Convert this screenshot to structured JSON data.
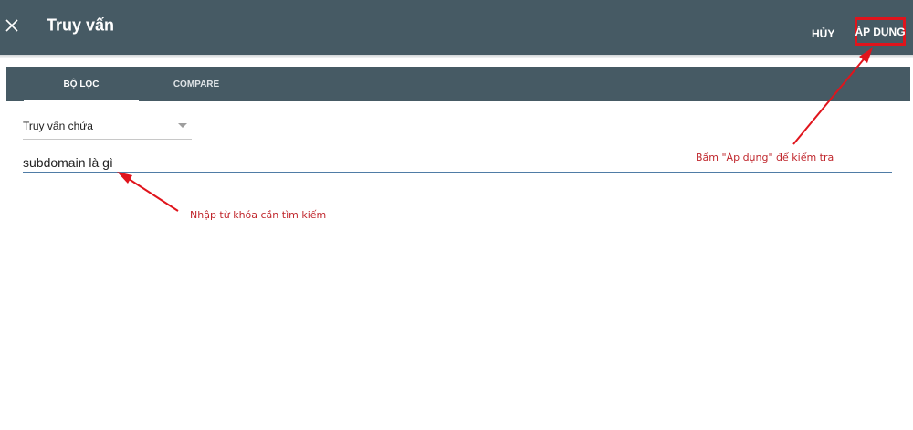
{
  "header": {
    "title": "Truy vấn",
    "cancel_label": "HỦY",
    "apply_label": "ÁP DỤNG",
    "close_icon": "close-icon"
  },
  "tabs": [
    {
      "label": "BỘ LỌC",
      "active": true
    },
    {
      "label": "COMPARE",
      "active": false
    }
  ],
  "filter": {
    "select_value": "Truy vấn chứa",
    "query_value": "subdomain là gì"
  },
  "annotations": {
    "apply_hint": "Bấm \"Áp dụng\" để kiểm tra",
    "keyword_hint": "Nhập từ khóa cần tìm kiếm"
  },
  "colors": {
    "header_bg": "#465a64",
    "annotation_red": "#c0272d",
    "highlight_box": "#e0141c"
  }
}
